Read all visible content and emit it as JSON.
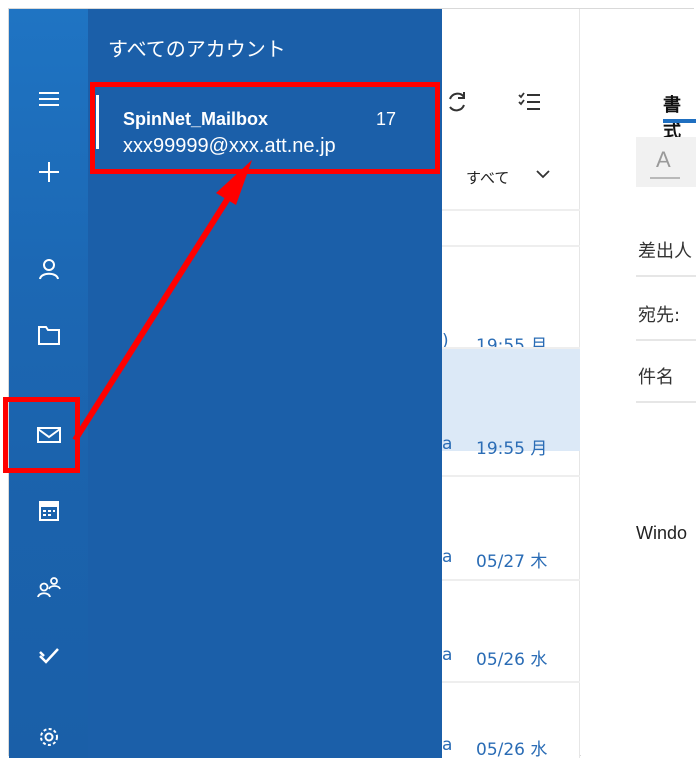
{
  "flyout": {
    "title": "すべてのアカウント",
    "account": {
      "name": "SpinNet_Mailbox",
      "count": "17",
      "email": "xxx99999@xxx.att.ne.jp"
    }
  },
  "rail": {
    "icons": [
      "hamburger-icon",
      "plus-icon",
      "person-icon",
      "folder-icon",
      "mail-icon",
      "calendar-icon",
      "people-icon",
      "todo-icon",
      "gear-icon"
    ]
  },
  "list": {
    "filter_label": "すべて",
    "rows": [
      {
        "fragment": ")",
        "time": "19:55 月",
        "selected": false
      },
      {
        "fragment": "a",
        "time": "19:55 月",
        "selected": true
      },
      {
        "fragment": "a",
        "time": "05/27 木",
        "selected": false
      },
      {
        "fragment": "a",
        "time": "05/26 水",
        "selected": false
      },
      {
        "fragment": "a",
        "time": "05/26 水",
        "selected": false
      }
    ]
  },
  "compose": {
    "tab_label": "書式",
    "format_letter": "A",
    "from_label": "差出人",
    "to_label": "宛先:",
    "subject_label": "件名",
    "body_fragment": "Windo"
  },
  "colors": {
    "rail": "#1c68b4",
    "flyout": "#1b5fa9",
    "highlight": "#ff0000",
    "selected_row": "#dce9f7",
    "accent": "#1f6fc0"
  }
}
